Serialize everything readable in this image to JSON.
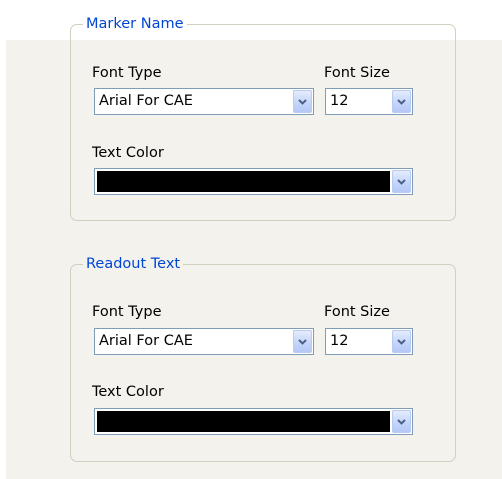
{
  "marker_name": {
    "title": "Marker Name",
    "font_type_label": "Font Type",
    "font_type_value": "Arial For CAE",
    "font_size_label": "Font Size",
    "font_size_value": "12",
    "text_color_label": "Text Color",
    "text_color_value": "#000000"
  },
  "readout_text": {
    "title": "Readout Text",
    "font_type_label": "Font Type",
    "font_type_value": "Arial For CAE",
    "font_size_label": "Font Size",
    "font_size_value": "12",
    "text_color_label": "Text Color",
    "text_color_value": "#000000"
  },
  "colors": {
    "legend_text": "#0046d5",
    "group_border": "#d0d0bf",
    "combo_border": "#7f9db9",
    "panel_background": "#f3f2ec"
  },
  "icons": {
    "dropdown": "chevron-down-icon"
  }
}
